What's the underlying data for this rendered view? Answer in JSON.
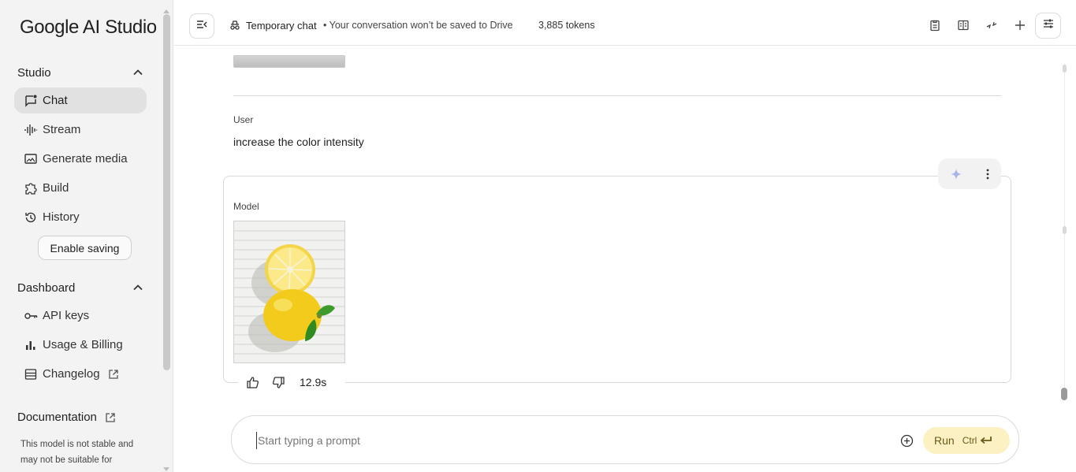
{
  "app": {
    "logo": "Google AI Studio"
  },
  "sidebar": {
    "studio_heading": "Studio",
    "studio_items": [
      {
        "label": "Chat",
        "icon": "chat-icon",
        "active": true
      },
      {
        "label": "Stream",
        "icon": "waveform-icon"
      },
      {
        "label": "Generate media",
        "icon": "image-icon"
      },
      {
        "label": "Build",
        "icon": "puzzle-icon"
      },
      {
        "label": "History",
        "icon": "history-icon"
      }
    ],
    "enable_saving": "Enable saving",
    "dashboard_heading": "Dashboard",
    "dashboard_items": [
      {
        "label": "API keys",
        "icon": "key-icon"
      },
      {
        "label": "Usage & Billing",
        "icon": "bar-chart-icon"
      },
      {
        "label": "Changelog",
        "icon": "list-icon",
        "external": true
      }
    ],
    "documentation": "Documentation",
    "note": "This model is not stable and may not be suitable for"
  },
  "header": {
    "temp_chat": "Temporary chat",
    "drive_note": "• Your conversation won’t be saved to Drive",
    "tokens": "3,885 tokens"
  },
  "chat": {
    "user_label": "User",
    "user_message": "increase the color intensity",
    "model_label": "Model",
    "response_time": "12.9s"
  },
  "prompt": {
    "placeholder": "Start typing a prompt",
    "run_label": "Run",
    "run_shortcut": "Ctrl"
  },
  "colors": {
    "sidebar_bg": "#f3f3f3",
    "active_item_bg": "#e1e1e1",
    "run_button_bg": "#fbf1c2",
    "sparkle": "#a8b4e8"
  }
}
